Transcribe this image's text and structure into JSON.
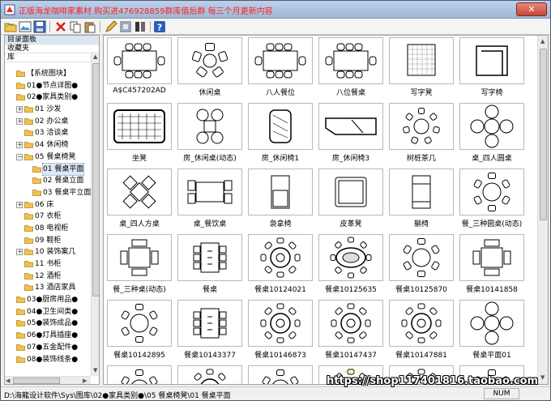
{
  "window": {
    "title": "正版海龙咖啡家素材 购买进476928859群库值后群 每三个月更新内容",
    "close_label": "✕"
  },
  "toolbar": {
    "icons": [
      "open-folder-icon",
      "image-icon",
      "save-icon",
      "cut-icon",
      "delete-icon",
      "copy-icon",
      "paste-icon",
      "edit-pen-icon",
      "block-icon",
      "layers-icon",
      "help-icon"
    ]
  },
  "left_panel": {
    "headers": [
      "目录面板",
      "收藏夹",
      "库"
    ],
    "tree": [
      {
        "label": "【系统图块】",
        "level": 0,
        "expander": "",
        "selected": false
      },
      {
        "label": "01●节点详图●",
        "level": 0,
        "expander": "",
        "selected": false
      },
      {
        "label": "02●家具类别●",
        "level": 0,
        "expander": "",
        "selected": false
      },
      {
        "label": "01 沙发",
        "level": 1,
        "expander": "+",
        "selected": false
      },
      {
        "label": "02 办公桌",
        "level": 1,
        "expander": "+",
        "selected": false
      },
      {
        "label": "03 洽谈桌",
        "level": 1,
        "expander": "",
        "selected": false
      },
      {
        "label": "04 休闲椅",
        "level": 1,
        "expander": "+",
        "selected": false
      },
      {
        "label": "05 餐桌椅凳",
        "level": 1,
        "expander": "−",
        "selected": false
      },
      {
        "label": "01 餐桌平面",
        "level": 2,
        "expander": "",
        "selected": true
      },
      {
        "label": "02 餐桌立面",
        "level": 2,
        "expander": "",
        "selected": false
      },
      {
        "label": "03 餐桌平立面",
        "level": 2,
        "expander": "",
        "selected": false
      },
      {
        "label": "06 床",
        "level": 1,
        "expander": "+",
        "selected": false
      },
      {
        "label": "07 衣柜",
        "level": 1,
        "expander": "",
        "selected": false
      },
      {
        "label": "08 电视柜",
        "level": 1,
        "expander": "",
        "selected": false
      },
      {
        "label": "09 鞋柜",
        "level": 1,
        "expander": "",
        "selected": false
      },
      {
        "label": "10 装饰案几",
        "level": 1,
        "expander": "+",
        "selected": false
      },
      {
        "label": "11 书柜",
        "level": 1,
        "expander": "",
        "selected": false
      },
      {
        "label": "12 酒柜",
        "level": 1,
        "expander": "",
        "selected": false
      },
      {
        "label": "13 酒店家具",
        "level": 1,
        "expander": "",
        "selected": false
      },
      {
        "label": "03●厨房用品●",
        "level": 0,
        "expander": "",
        "selected": false
      },
      {
        "label": "04●卫生间类●",
        "level": 0,
        "expander": "",
        "selected": false
      },
      {
        "label": "05●装饰成品●",
        "level": 0,
        "expander": "",
        "selected": false
      },
      {
        "label": "06●灯具插座●",
        "level": 0,
        "expander": "",
        "selected": false
      },
      {
        "label": "07●五金配件●",
        "level": 0,
        "expander": "",
        "selected": false
      },
      {
        "label": "08●装饰线条●",
        "level": 0,
        "expander": "",
        "selected": false
      }
    ]
  },
  "blocks": [
    {
      "label": "A$C457202AD",
      "icon": "dining-table-8-icon"
    },
    {
      "label": "休闲桌",
      "icon": "lounge-table-icon"
    },
    {
      "label": "八人餐位",
      "icon": "dining-table-8-icon"
    },
    {
      "label": "八位餐桌",
      "icon": "dining-table-8-icon"
    },
    {
      "label": "写字凳",
      "icon": "stool-icon"
    },
    {
      "label": "写字椅",
      "icon": "armchair-icon"
    },
    {
      "label": "坐凳",
      "icon": "cushion-stool-icon"
    },
    {
      "label": "房_休闲桌(动态)",
      "icon": "four-chair-table-icon"
    },
    {
      "label": "房_休闲椅1",
      "icon": "lounge-chair-icon"
    },
    {
      "label": "房_休闲椅3",
      "icon": "chaise-icon"
    },
    {
      "label": "树桩茶几",
      "icon": "tea-table-icon"
    },
    {
      "label": "桌_四人圆桌",
      "icon": "round-table-4-icon"
    },
    {
      "label": "桌_四人方桌",
      "icon": "square-table-4-icon"
    },
    {
      "label": "桌_餐饮桌",
      "icon": "booth-table-icon"
    },
    {
      "label": "袅拿椅",
      "icon": "bench-chair-icon"
    },
    {
      "label": "皮革凳",
      "icon": "leather-stool-icon"
    },
    {
      "label": "躺椅",
      "icon": "recliner-icon"
    },
    {
      "label": "餐_三种圆桌(动态)",
      "icon": "round-table-6-icon"
    },
    {
      "label": "餐_三种桌(动态)",
      "icon": "rect-table-4-icon"
    },
    {
      "label": "餐桌",
      "icon": "rect-table-6-icon"
    },
    {
      "label": "餐桌10124021",
      "icon": "round-table-8-icon"
    },
    {
      "label": "餐桌10125635",
      "icon": "oval-table-icon"
    },
    {
      "label": "餐桌10125870",
      "icon": "round-table-6-icon"
    },
    {
      "label": "餐桌10141858",
      "icon": "rect-table-4-icon"
    },
    {
      "label": "餐桌10142895",
      "icon": "round-table-6-icon"
    },
    {
      "label": "餐桌10143377",
      "icon": "rect-table-6-icon"
    },
    {
      "label": "餐桌10146873",
      "icon": "round-table-8-icon"
    },
    {
      "label": "餐桌10147437",
      "icon": "round-table-8-icon"
    },
    {
      "label": "餐桌10147881",
      "icon": "round-table-8-icon"
    },
    {
      "label": "餐桌平面01",
      "icon": "round-table-4-icon"
    },
    {
      "label": "",
      "icon": "round-table-6-icon"
    },
    {
      "label": "",
      "icon": "round-table-8-icon"
    },
    {
      "label": "",
      "icon": "round-table-6-icon"
    },
    {
      "label": "",
      "icon": "round-table-8-icon"
    },
    {
      "label": "",
      "icon": "round-table-8-icon"
    },
    {
      "label": "",
      "icon": "round-table-6-icon"
    }
  ],
  "status": {
    "path": "D:\\海龍设计软件\\Sys\\图库\\02●家具类别●\\05 餐桌椅凳\\01 餐桌平面",
    "num": "NUM"
  },
  "watermark": {
    "url": "https://shop117401816.taobao.com",
    "small": "........"
  }
}
